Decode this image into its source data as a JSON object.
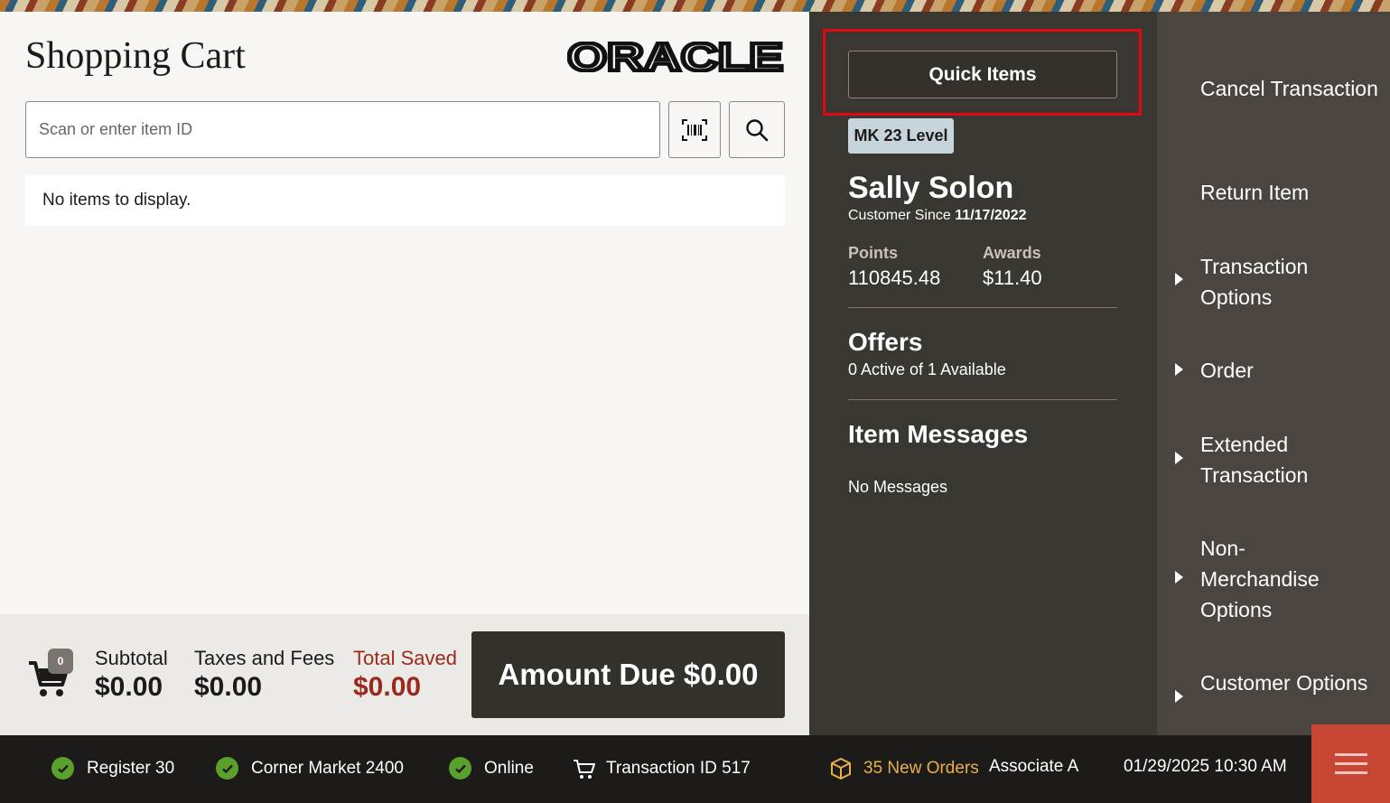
{
  "header": {
    "title": "Shopping Cart",
    "logo_text": "ORACLE"
  },
  "search": {
    "placeholder": "Scan or enter item ID",
    "value": ""
  },
  "cart": {
    "empty_message": "No items to display.",
    "item_count": "0"
  },
  "totals": {
    "subtotal_label": "Subtotal",
    "subtotal_value": "$0.00",
    "taxes_label": "Taxes and Fees",
    "taxes_value": "$0.00",
    "saved_label": "Total Saved",
    "saved_value": "$0.00",
    "amount_due_label": "Amount Due $0.00"
  },
  "customer": {
    "quick_items_label": "Quick Items",
    "level_badge": "MK 23 Level",
    "name": "Sally Solon",
    "since_label": "Customer Since",
    "since_date": "11/17/2022",
    "points_label": "Points",
    "points_value": "110845.48",
    "awards_label": "Awards",
    "awards_value": "$11.40",
    "offers_title": "Offers",
    "offers_sub": "0 Active of 1 Available",
    "messages_title": "Item Messages",
    "messages_sub": "No Messages"
  },
  "menu": {
    "items": [
      {
        "label": "Cancel Transaction",
        "has_submenu": false
      },
      {
        "label": "Return Item",
        "has_submenu": false
      },
      {
        "label": "Transaction Options",
        "has_submenu": true
      },
      {
        "label": "Order",
        "has_submenu": true
      },
      {
        "label": "Extended Transaction",
        "has_submenu": true
      },
      {
        "label": "Non-Merchandise Options",
        "has_submenu": true
      },
      {
        "label": "Customer Options",
        "has_submenu": true
      }
    ]
  },
  "status": {
    "register": "Register 30",
    "store": "Corner Market 2400",
    "connection": "Online",
    "transaction": "Transaction ID 517",
    "orders": "35 New Orders",
    "associate": "Associate A",
    "datetime": "01/29/2025 10:30 AM"
  },
  "colors": {
    "accent_red": "#c74634",
    "highlight_red": "#e30613",
    "saved_red": "#9b2a1e",
    "status_green": "#5aa02c",
    "orders_gold": "#e8b04a"
  }
}
